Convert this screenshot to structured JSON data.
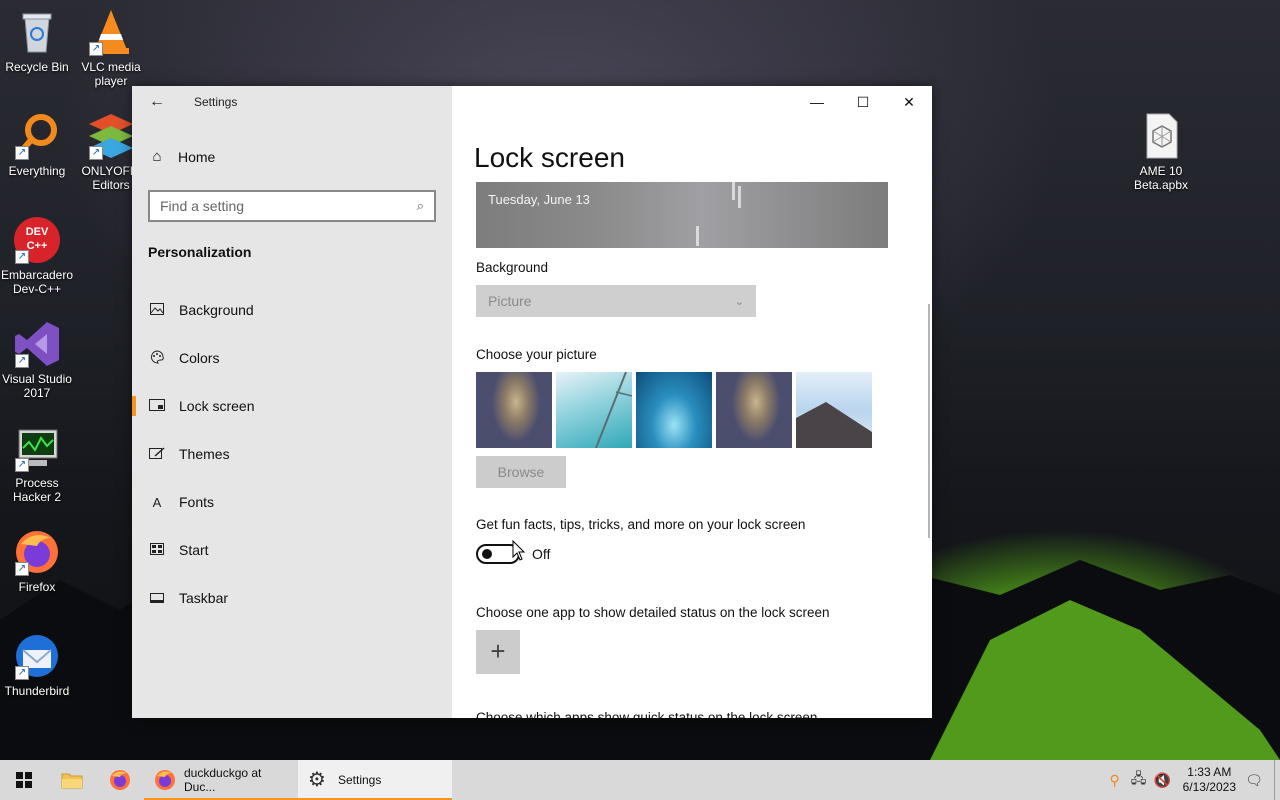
{
  "desktop": {
    "icons": [
      {
        "label": "Recycle Bin",
        "icon": "recycle-bin-icon"
      },
      {
        "label": "VLC media player",
        "icon": "vlc-icon"
      },
      {
        "label": "Everything",
        "icon": "everything-icon"
      },
      {
        "label": "ONLYOFFI Editors",
        "icon": "onlyoffice-icon"
      },
      {
        "label": "Embarcadero Dev-C++",
        "icon": "devcpp-icon"
      },
      {
        "label": "Visual Studio 2017",
        "icon": "visual-studio-icon"
      },
      {
        "label": "Process Hacker 2",
        "icon": "process-hacker-icon"
      },
      {
        "label": "Firefox",
        "icon": "firefox-icon"
      },
      {
        "label": "Thunderbird",
        "icon": "thunderbird-icon"
      },
      {
        "label": "AME 10 Beta.apbx",
        "icon": "apbx-file-icon"
      }
    ],
    "devcpp_badge": "DEV C++"
  },
  "settings": {
    "window_title": "Settings",
    "home_label": "Home",
    "search_placeholder": "Find a setting",
    "section_title": "Personalization",
    "nav": [
      {
        "label": "Background",
        "icon": "picture-icon"
      },
      {
        "label": "Colors",
        "icon": "palette-icon"
      },
      {
        "label": "Lock screen",
        "icon": "lock-screen-icon",
        "active": true
      },
      {
        "label": "Themes",
        "icon": "themes-icon"
      },
      {
        "label": "Fonts",
        "icon": "fonts-icon",
        "glyph": "A"
      },
      {
        "label": "Start",
        "icon": "start-icon"
      },
      {
        "label": "Taskbar",
        "icon": "taskbar-icon"
      }
    ],
    "page_title": "Lock screen",
    "preview_date": "Tuesday, June 13",
    "background_label": "Background",
    "background_value": "Picture",
    "choose_picture_label": "Choose your picture",
    "browse_label": "Browse",
    "fun_facts_label": "Get fun facts, tips, tricks, and more on your lock screen",
    "fun_facts_state": "Off",
    "detailed_status_label": "Choose one app to show detailed status on the lock screen",
    "add_app_glyph": "+",
    "quick_status_label": "Choose which apps show quick status on the lock screen"
  },
  "taskbar": {
    "tasks": [
      {
        "label": "duckduckgo at Duc...",
        "icon": "firefox-icon"
      },
      {
        "label": "Settings",
        "icon": "gear-icon",
        "active": true
      }
    ],
    "clock_time": "1:33 AM",
    "clock_date": "6/13/2023"
  },
  "colors": {
    "accent": "#f7941d",
    "sidebar_bg": "#e6e6e6",
    "taskbar_bg": "#d9d9d9"
  }
}
